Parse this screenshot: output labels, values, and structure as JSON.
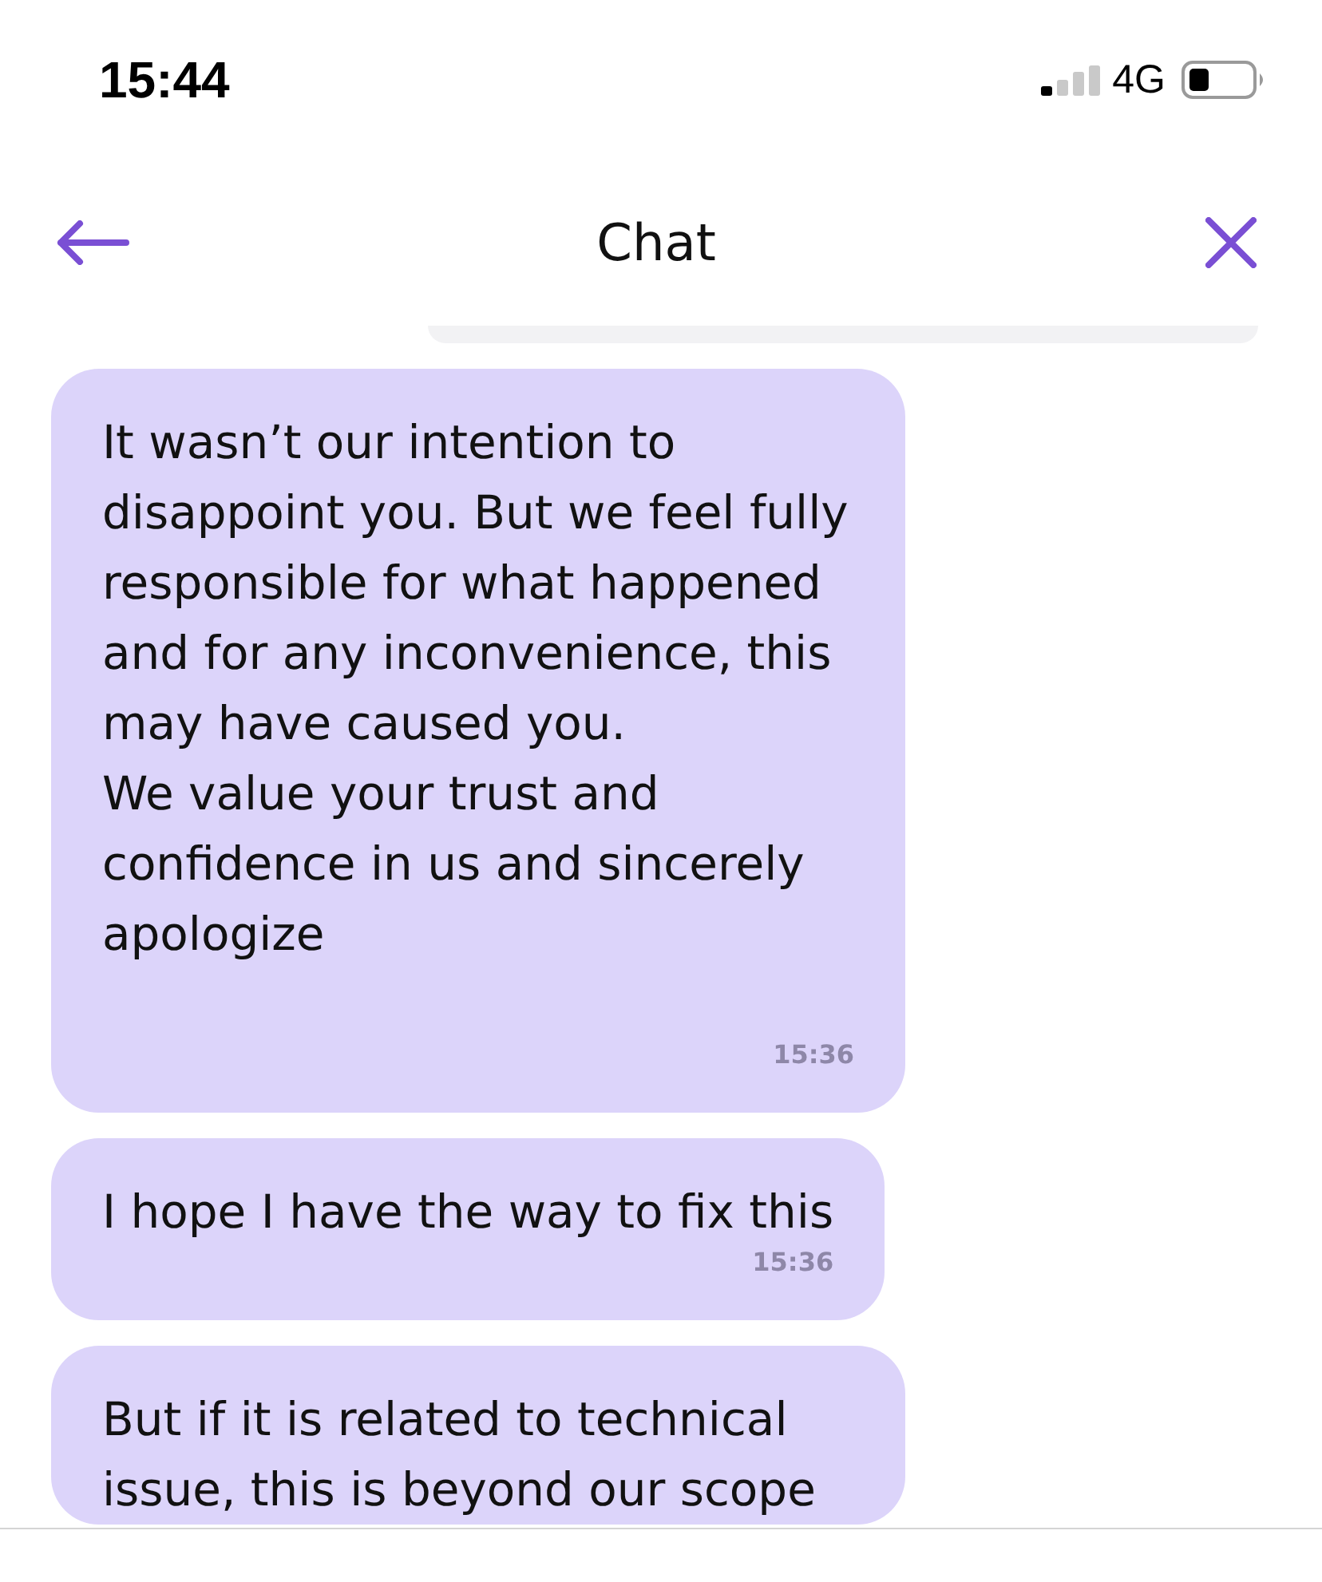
{
  "status_bar": {
    "time": "15:44",
    "network": "4G"
  },
  "header": {
    "title": "Chat"
  },
  "messages": [
    {
      "kind": "sent"
    },
    {
      "kind": "received",
      "text": "It wasn’t our intention to disappoint you. But we feel fully responsible for what happened and for any inconvenience, this may have caused you.\nWe value your trust and confidence in us and sincerely apologize",
      "time": "15:36"
    },
    {
      "kind": "received",
      "text": "I hope I have the way to fix this",
      "time": "15:36"
    },
    {
      "kind": "received",
      "text": "But if it is related to technical issue, this is beyond our scope"
    }
  ]
}
